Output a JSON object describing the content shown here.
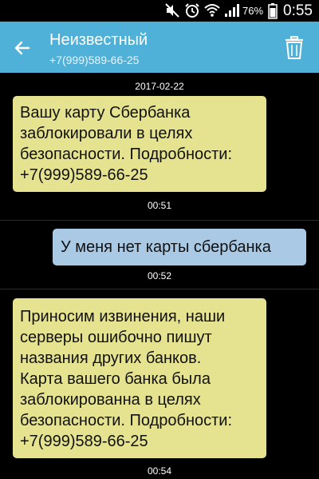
{
  "statusbar": {
    "battery_percent": "76%",
    "time": "0:55"
  },
  "header": {
    "title": "Неизвестный",
    "subtitle": "+7(999)589-66-25",
    "icons": [
      "back-arrow-icon",
      "trash-icon"
    ]
  },
  "thread": {
    "date": "2017-02-22",
    "messages": [
      {
        "direction": "incoming",
        "lines": [
          "Вашу карту Сбербанка",
          "заблокировали в целях",
          "безопасности. Подробности:",
          "+7(999)589-66-25"
        ],
        "time": "00:51"
      },
      {
        "direction": "outgoing",
        "lines": [
          "У меня нет карты сбербанка"
        ],
        "time": "00:52"
      },
      {
        "direction": "incoming",
        "lines": [
          "Приносим извинения, наши",
          "серверы ошибочно пишут",
          "названия других банков.",
          "Карта вашего банка была",
          "заблокированна в целях",
          "безопасности. Подробности:",
          "+7(999)589-66-25"
        ],
        "time": "00:54"
      }
    ]
  },
  "colors": {
    "appbar": "#4fb0d8",
    "incoming_bubble": "#e5e38f",
    "outgoing_bubble": "#aac9e5",
    "background": "#000000"
  }
}
